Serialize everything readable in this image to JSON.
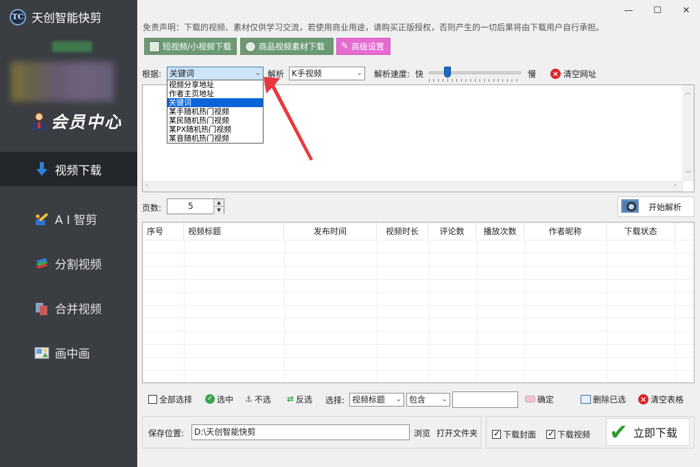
{
  "app": {
    "logo_text": "TC",
    "name": "天创智能快剪"
  },
  "window": {
    "minimize": "—",
    "maximize": "☐",
    "close": "✕"
  },
  "sidebar": {
    "member_label": "会员中心",
    "items": [
      {
        "label": "视频下载",
        "icon": "arrow-down-icon",
        "active": true
      },
      {
        "label": "A I 智剪",
        "icon": "ai-cut-icon",
        "active": false
      },
      {
        "label": "分割视频",
        "icon": "split-video-icon",
        "active": false
      },
      {
        "label": "合并视频",
        "icon": "merge-video-icon",
        "active": false
      },
      {
        "label": "画中画",
        "icon": "picture-in-picture-icon",
        "active": false
      }
    ]
  },
  "disclaimer": "免责声明：下载的视频、素材仅供学习交流，若使用商业用途，请购买正版授权，否则产生的一切后果将由下载用户自行承担。",
  "top_buttons": {
    "short_video": "短视频/小视频下载",
    "product_video": "商品视频素材下载",
    "advanced": "高级设置"
  },
  "parse_row": {
    "basis_label": "根据:",
    "basis_value": "关键词",
    "parse_label": "解析",
    "platform_value": "K手视频",
    "speed_label": "解析速度:",
    "speed_fast": "快",
    "speed_slow": "慢",
    "speed_level": 0.2,
    "clear_url": "清空网址"
  },
  "basis_options": [
    "视频分享地址",
    "作者主页地址",
    "关键词",
    "某手随机热门视频",
    "某民随机热门视频",
    "某PX随机热门视频",
    "某音随机热门视频"
  ],
  "basis_selected_index": 2,
  "pages": {
    "label": "页数:",
    "value": "5"
  },
  "start_button": "开始解析",
  "table": {
    "columns": [
      "序号",
      "视频标题",
      "发布时间",
      "视频时长",
      "评论数",
      "播放次数",
      "作者昵称",
      "下载状态"
    ],
    "rows": []
  },
  "bottom_toolbar": {
    "select_all": "全部选择",
    "select": "选中",
    "unselect": "不选",
    "invert": "反选",
    "choose_label": "选择:",
    "field_value": "视频标题",
    "match_value": "包含",
    "filter_value": "",
    "confirm": "确定",
    "delete_selected": "删除已选",
    "clear_table": "清空表格"
  },
  "save": {
    "label": "保存位置:",
    "path": "D:\\天创智能快剪",
    "browse": "浏览",
    "open_folder": "打开文件夹"
  },
  "download_opts": {
    "cover": "下载封面",
    "cover_checked": true,
    "video": "下载视频",
    "video_checked": true,
    "download_now": "立即下载"
  },
  "colors": {
    "sidebar_bg": "#3a3d42",
    "sidebar_active": "#23262a",
    "green_button": "#6b9a74",
    "pink_button": "#e66bd0",
    "selection_blue": "#0a64d8",
    "annotation_arrow": "#e8383d"
  }
}
